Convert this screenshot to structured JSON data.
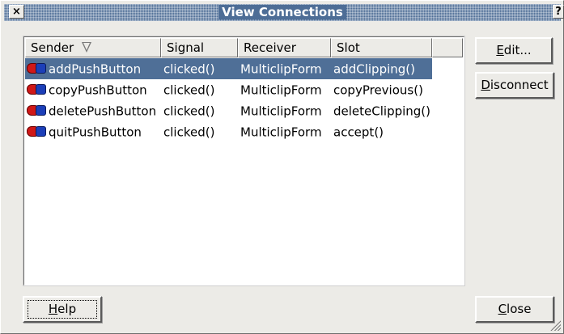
{
  "window": {
    "title": "View Connections",
    "close_glyph": "×",
    "help_glyph": "?"
  },
  "table": {
    "columns": [
      "Sender",
      "Signal",
      "Receiver",
      "Slot"
    ],
    "sort_indicator_icon": "sort-descending-icon",
    "rows": [
      {
        "sender": "addPushButton",
        "signal": "clicked()",
        "receiver": "MulticlipForm",
        "slot": "addClipping()",
        "selected": true
      },
      {
        "sender": "copyPushButton",
        "signal": "clicked()",
        "receiver": "MulticlipForm",
        "slot": "copyPrevious()",
        "selected": false
      },
      {
        "sender": "deletePushButton",
        "signal": "clicked()",
        "receiver": "MulticlipForm",
        "slot": "deleteClipping()",
        "selected": false
      },
      {
        "sender": "quitPushButton",
        "signal": "clicked()",
        "receiver": "MulticlipForm",
        "slot": "accept()",
        "selected": false
      }
    ]
  },
  "buttons": {
    "edit": {
      "mnemonic": "E",
      "rest": "dit..."
    },
    "disconnect": {
      "mnemonic": "D",
      "rest": "isconnect"
    },
    "help": {
      "mnemonic": "H",
      "rest": "elp"
    },
    "close": {
      "mnemonic": "C",
      "rest": "lose"
    }
  },
  "colors": {
    "selection": "#4f6f97",
    "title_bar": "#4d6d96",
    "window_bg": "#ecebe7"
  }
}
